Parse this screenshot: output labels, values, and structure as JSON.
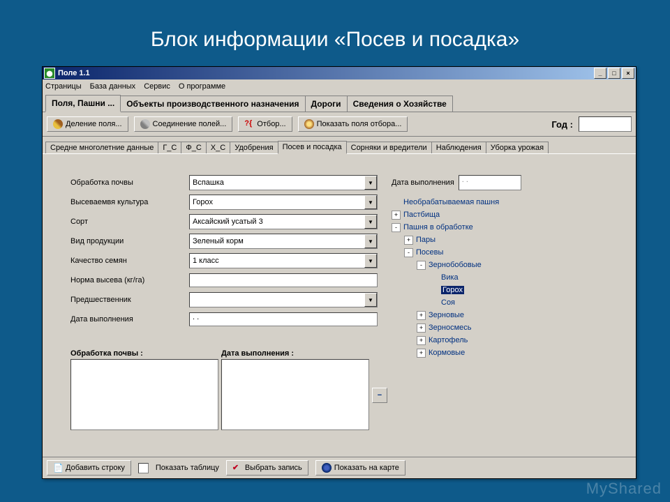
{
  "slide_title": "Блок информации «Посев и посадка»",
  "window": {
    "title": "Поле 1.1",
    "menu": [
      "Страницы",
      "База данных",
      "Сервис",
      "О программе"
    ],
    "main_tabs": [
      {
        "label": "Поля, Пашни ...",
        "active": true
      },
      {
        "label": "Объекты производственного назначения",
        "active": false
      },
      {
        "label": "Дороги",
        "active": false
      },
      {
        "label": "Сведения о Хозяйстве",
        "active": false
      }
    ],
    "toolbar": {
      "split": "Деление поля...",
      "join": "Соединение полей...",
      "filter": "Отбор...",
      "show": "Показать поля отбора...",
      "year_label": "Год :"
    },
    "sub_tabs": [
      {
        "label": "Средне многолетние данные",
        "active": false
      },
      {
        "label": "Г_С",
        "active": false
      },
      {
        "label": "Ф_С",
        "active": false
      },
      {
        "label": "Х_С",
        "active": false
      },
      {
        "label": "Удобрения",
        "active": false
      },
      {
        "label": "Посев и посадка",
        "active": true
      },
      {
        "label": "Сорняки и вредители",
        "active": false
      },
      {
        "label": "Наблюдения",
        "active": false
      },
      {
        "label": "Уборка урожая",
        "active": false
      }
    ],
    "form": {
      "rows": [
        {
          "label": "Обработка почвы",
          "value": "Вспашка",
          "type": "combo"
        },
        {
          "label": "Высеваемвя культура",
          "value": "Горох",
          "type": "combo"
        },
        {
          "label": "Сорт",
          "value": "Аксайский усатый 3",
          "type": "combo"
        },
        {
          "label": "Вид продукции",
          "value": "Зеленый корм",
          "type": "combo"
        },
        {
          "label": "Качество семян",
          "value": "1 класс",
          "type": "combo"
        },
        {
          "label": "Норма высева (кг/га)",
          "value": "",
          "type": "input"
        },
        {
          "label": "Предшественник",
          "value": "",
          "type": "combo"
        },
        {
          "label": "Дата выполнения",
          "value": " . .",
          "type": "input"
        }
      ],
      "date_top": {
        "label": "Дата выполнения",
        "value": " . ."
      }
    },
    "tree": [
      {
        "indent": 0,
        "exp": "",
        "label": "Необрабатываемая пашня",
        "sel": false
      },
      {
        "indent": 0,
        "exp": "+",
        "label": "Пастбища",
        "sel": false
      },
      {
        "indent": 0,
        "exp": "-",
        "label": "Пашня в обработке",
        "sel": false
      },
      {
        "indent": 1,
        "exp": "+",
        "label": "Пары",
        "sel": false
      },
      {
        "indent": 1,
        "exp": "-",
        "label": "Посевы",
        "sel": false
      },
      {
        "indent": 2,
        "exp": "-",
        "label": "Зернобобовые",
        "sel": false
      },
      {
        "indent": 3,
        "exp": "",
        "label": "Вика",
        "sel": false
      },
      {
        "indent": 3,
        "exp": "",
        "label": "Горох",
        "sel": true
      },
      {
        "indent": 3,
        "exp": "",
        "label": "Соя",
        "sel": false
      },
      {
        "indent": 2,
        "exp": "+",
        "label": "Зерновые",
        "sel": false
      },
      {
        "indent": 2,
        "exp": "+",
        "label": "Зерносмесь",
        "sel": false
      },
      {
        "indent": 2,
        "exp": "+",
        "label": "Картофель",
        "sel": false
      },
      {
        "indent": 2,
        "exp": "+",
        "label": "Кормовые",
        "sel": false
      }
    ],
    "lists": {
      "col1": "Обработка почвы :",
      "col2": "Дата выполнения :"
    },
    "bottom": {
      "add": "Добавить строку",
      "show_table": "Показать таблицу",
      "select": "Выбрать запись",
      "map": "Показать на карте"
    }
  }
}
